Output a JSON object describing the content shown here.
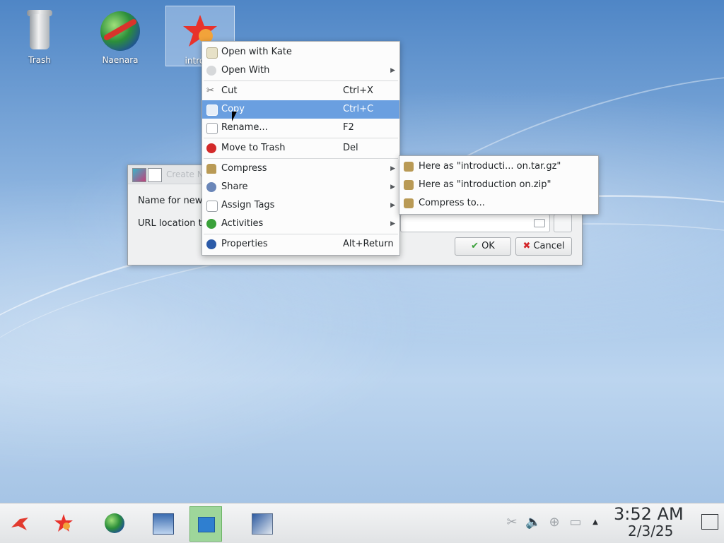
{
  "desktop": {
    "icons": [
      {
        "label": "Trash"
      },
      {
        "label": "Naenara"
      },
      {
        "label": "introdu"
      }
    ]
  },
  "dialog": {
    "title": "Create N",
    "name_label": "Name for new",
    "url_label": "URL location to",
    "ok_label": "OK",
    "cancel_label": "Cancel"
  },
  "context_menu": {
    "items": [
      {
        "label": "Open with Kate",
        "shortcut": ""
      },
      {
        "label": "Open With",
        "shortcut": ""
      },
      {
        "label": "Cut",
        "shortcut": "Ctrl+X"
      },
      {
        "label": "Copy",
        "shortcut": "Ctrl+C"
      },
      {
        "label": "Rename...",
        "shortcut": "F2"
      },
      {
        "label": "Move to Trash",
        "shortcut": "Del"
      },
      {
        "label": "Compress",
        "shortcut": ""
      },
      {
        "label": "Share",
        "shortcut": ""
      },
      {
        "label": "Assign Tags",
        "shortcut": ""
      },
      {
        "label": "Activities",
        "shortcut": ""
      },
      {
        "label": "Properties",
        "shortcut": "Alt+Return"
      }
    ],
    "highlighted": "Copy"
  },
  "submenu": {
    "items": [
      {
        "label": "Here as \"introducti... on.tar.gz\""
      },
      {
        "label": "Here as \"introduction on.zip\""
      },
      {
        "label": "Compress to..."
      }
    ]
  },
  "taskbar": {
    "clock_time": "3:52 AM",
    "clock_date": "2/3/25"
  },
  "colors": {
    "highlight": "#6a9fe0",
    "active_task": "#9ed69a"
  }
}
